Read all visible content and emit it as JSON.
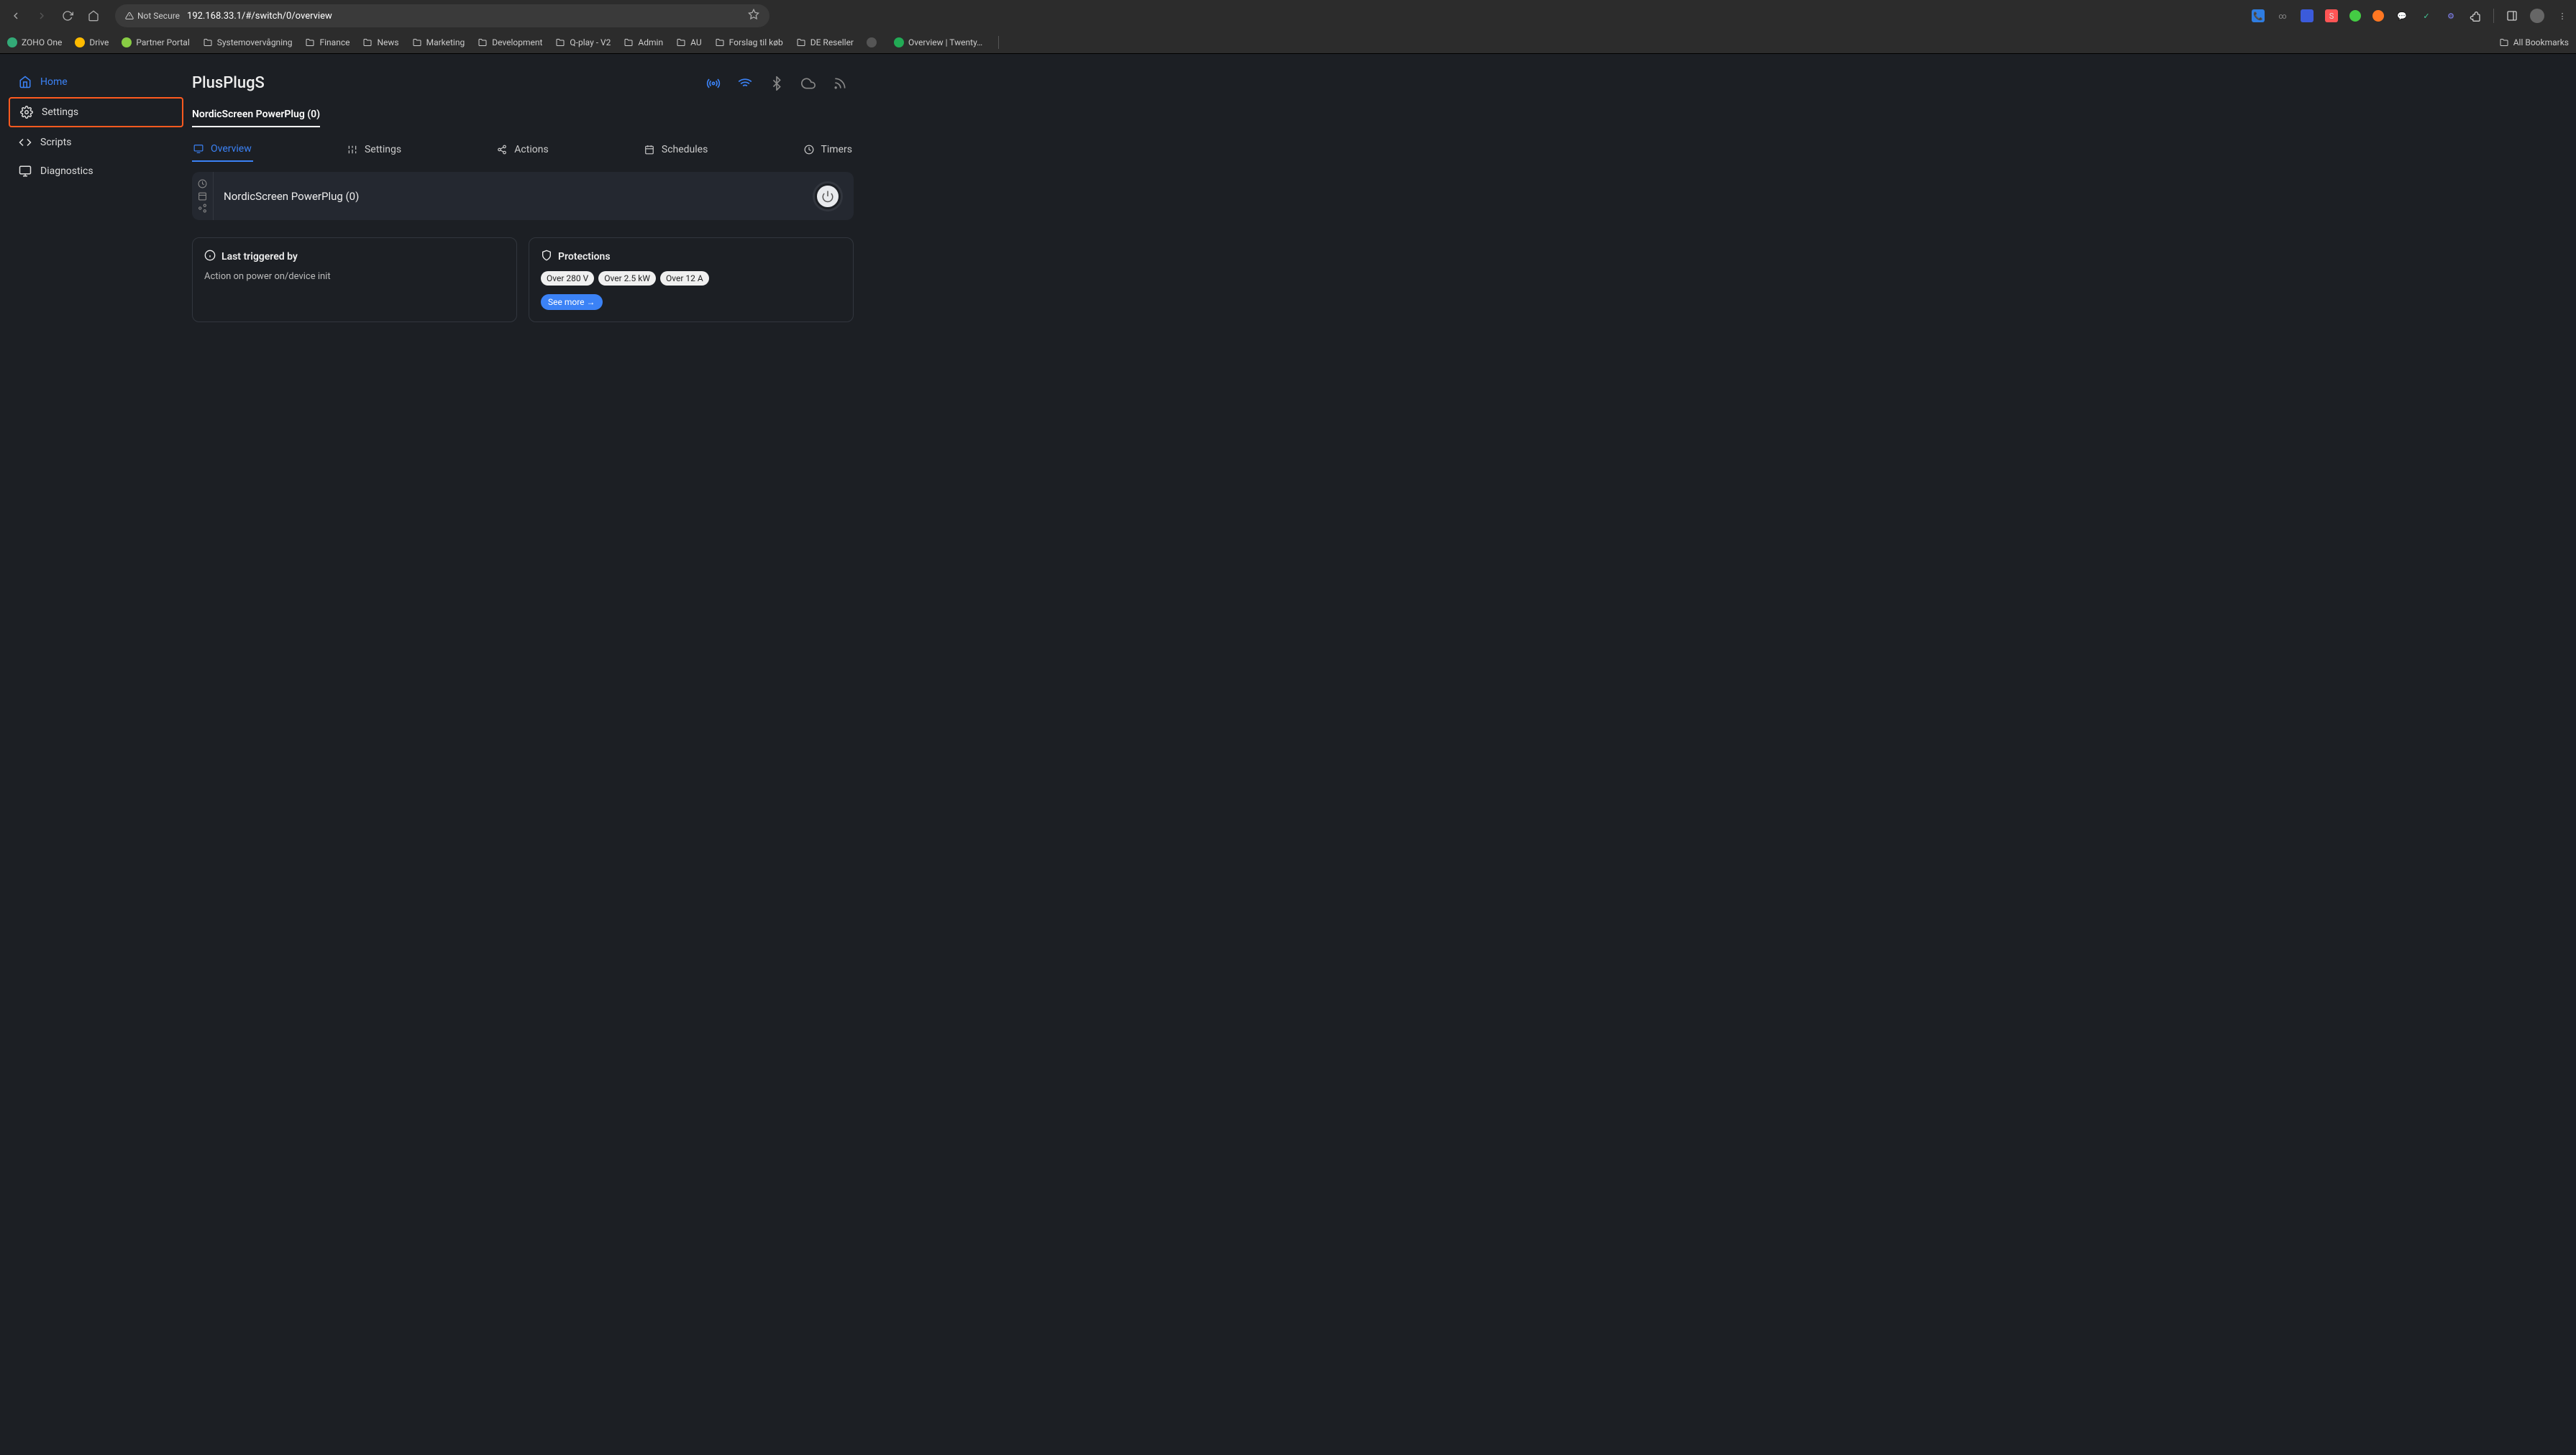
{
  "browser": {
    "not_secure": "Not Secure",
    "url": "192.168.33.1/#/switch/0/overview",
    "bookmarks": [
      {
        "label": "ZOHO One",
        "type": "icon",
        "color": "#3a7"
      },
      {
        "label": "Drive",
        "type": "icon",
        "color": "#fb0"
      },
      {
        "label": "Partner Portal",
        "type": "icon",
        "color": "#8c4"
      },
      {
        "label": "Systemovervågning",
        "type": "folder"
      },
      {
        "label": "Finance",
        "type": "folder"
      },
      {
        "label": "News",
        "type": "folder"
      },
      {
        "label": "Marketing",
        "type": "folder"
      },
      {
        "label": "Development",
        "type": "folder"
      },
      {
        "label": "Q-play - V2",
        "type": "folder"
      },
      {
        "label": "Admin",
        "type": "folder"
      },
      {
        "label": "AU",
        "type": "folder"
      },
      {
        "label": "Forslag til køb",
        "type": "folder"
      },
      {
        "label": "DE Reseller",
        "type": "folder"
      },
      {
        "label": "",
        "type": "icon",
        "color": "#555"
      },
      {
        "label": "Overview | Twenty…",
        "type": "icon",
        "color": "#2a5"
      }
    ],
    "all_bookmarks": "All Bookmarks"
  },
  "app": {
    "title": "PlusPlugS",
    "sidebar": [
      {
        "label": "Home",
        "icon": "home"
      },
      {
        "label": "Settings",
        "icon": "gear"
      },
      {
        "label": "Scripts",
        "icon": "code"
      },
      {
        "label": "Diagnostics",
        "icon": "monitor"
      }
    ],
    "breadcrumb": "NordicScreen PowerPlug (0)",
    "tabs": [
      {
        "label": "Overview",
        "icon": "monitor"
      },
      {
        "label": "Settings",
        "icon": "sliders"
      },
      {
        "label": "Actions",
        "icon": "share"
      },
      {
        "label": "Schedules",
        "icon": "calendar"
      },
      {
        "label": "Timers",
        "icon": "clock"
      }
    ],
    "device_name": "NordicScreen PowerPlug (0)",
    "cards": {
      "triggered": {
        "title": "Last triggered by",
        "body": "Action on power on/device init"
      },
      "protections": {
        "title": "Protections",
        "pills": [
          "Over 280 V",
          "Over 2.5 kW",
          "Over 12 A"
        ],
        "see_more": "See more →"
      }
    }
  }
}
